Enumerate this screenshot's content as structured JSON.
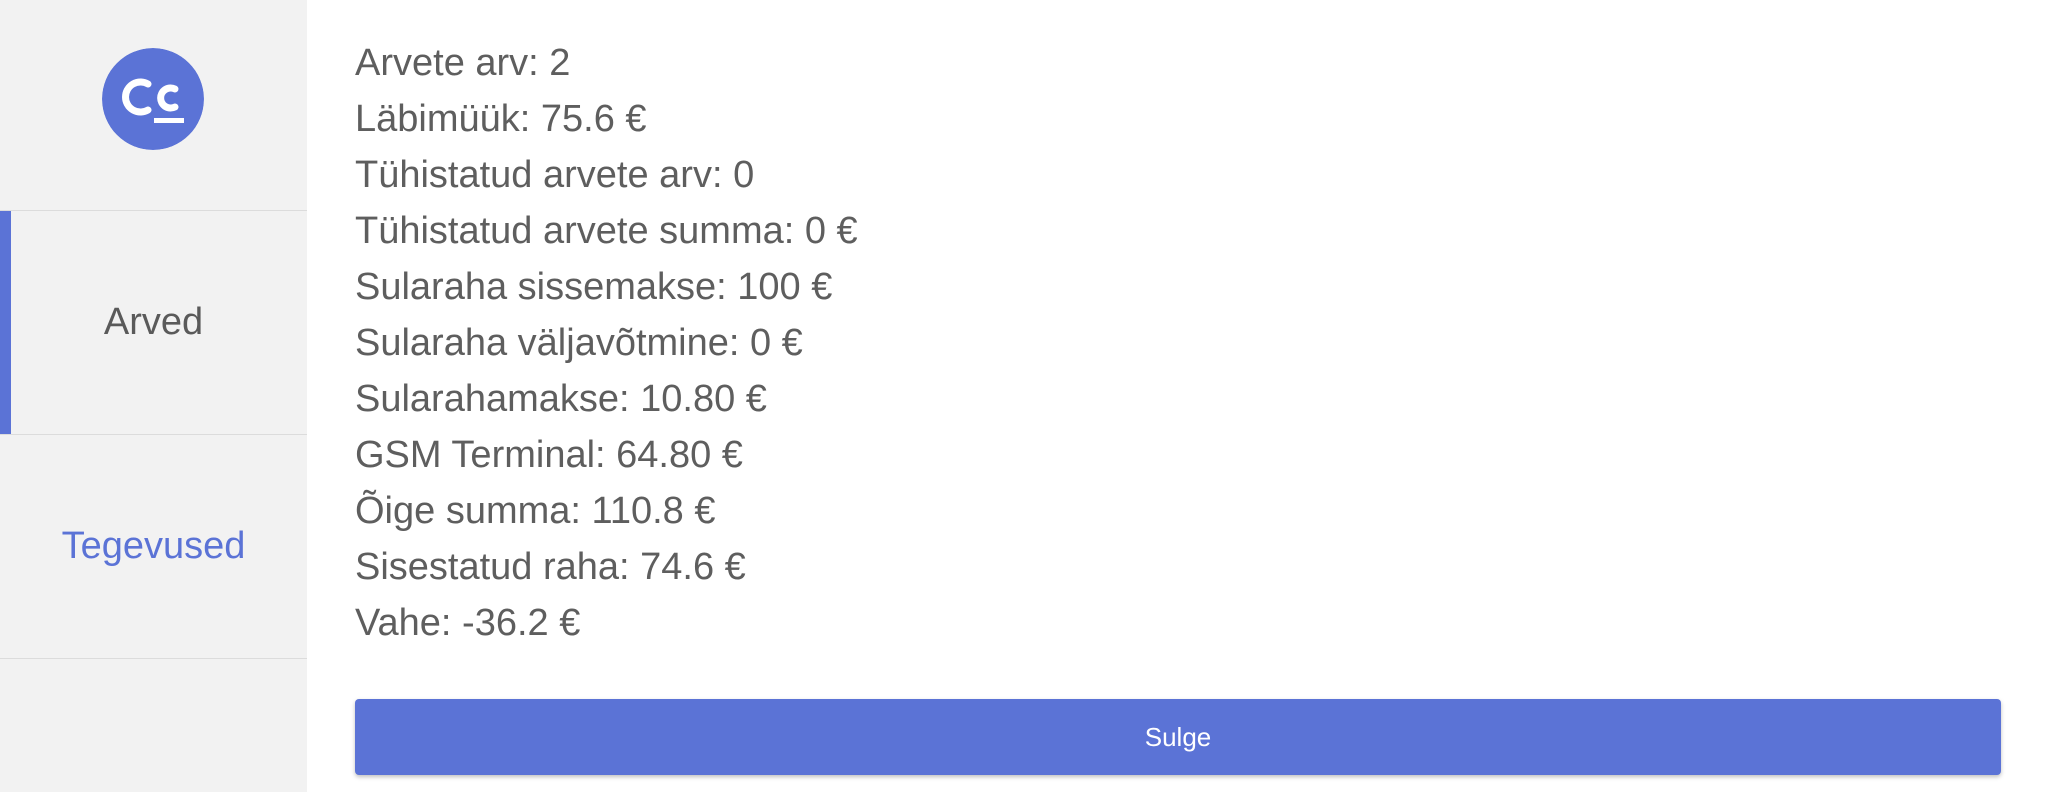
{
  "theme": {
    "accent": "#5b73d6",
    "sidebar_bg": "#f2f2f2",
    "text": "#5e5e5e"
  },
  "sidebar": {
    "logo_icon": "cc-logo-icon",
    "items": [
      {
        "label": "Arved",
        "active": true
      },
      {
        "label": "Tegevused",
        "active": false
      }
    ]
  },
  "summary": {
    "lines": [
      "Arvete arv: 2",
      "Läbimüük: 75.6 €",
      "Tühistatud arvete arv: 0",
      "Tühistatud arvete summa: 0 €",
      "Sularaha sissemakse: 100 €",
      "Sularaha väljavõtmine: 0 €",
      "Sularahamakse: 10.80 €",
      "GSM Terminal: 64.80 €",
      "Õige summa: 110.8 €",
      "Sisestatud raha: 74.6 €",
      "Vahe: -36.2 €"
    ]
  },
  "actions": {
    "close_label": "Sulge"
  }
}
